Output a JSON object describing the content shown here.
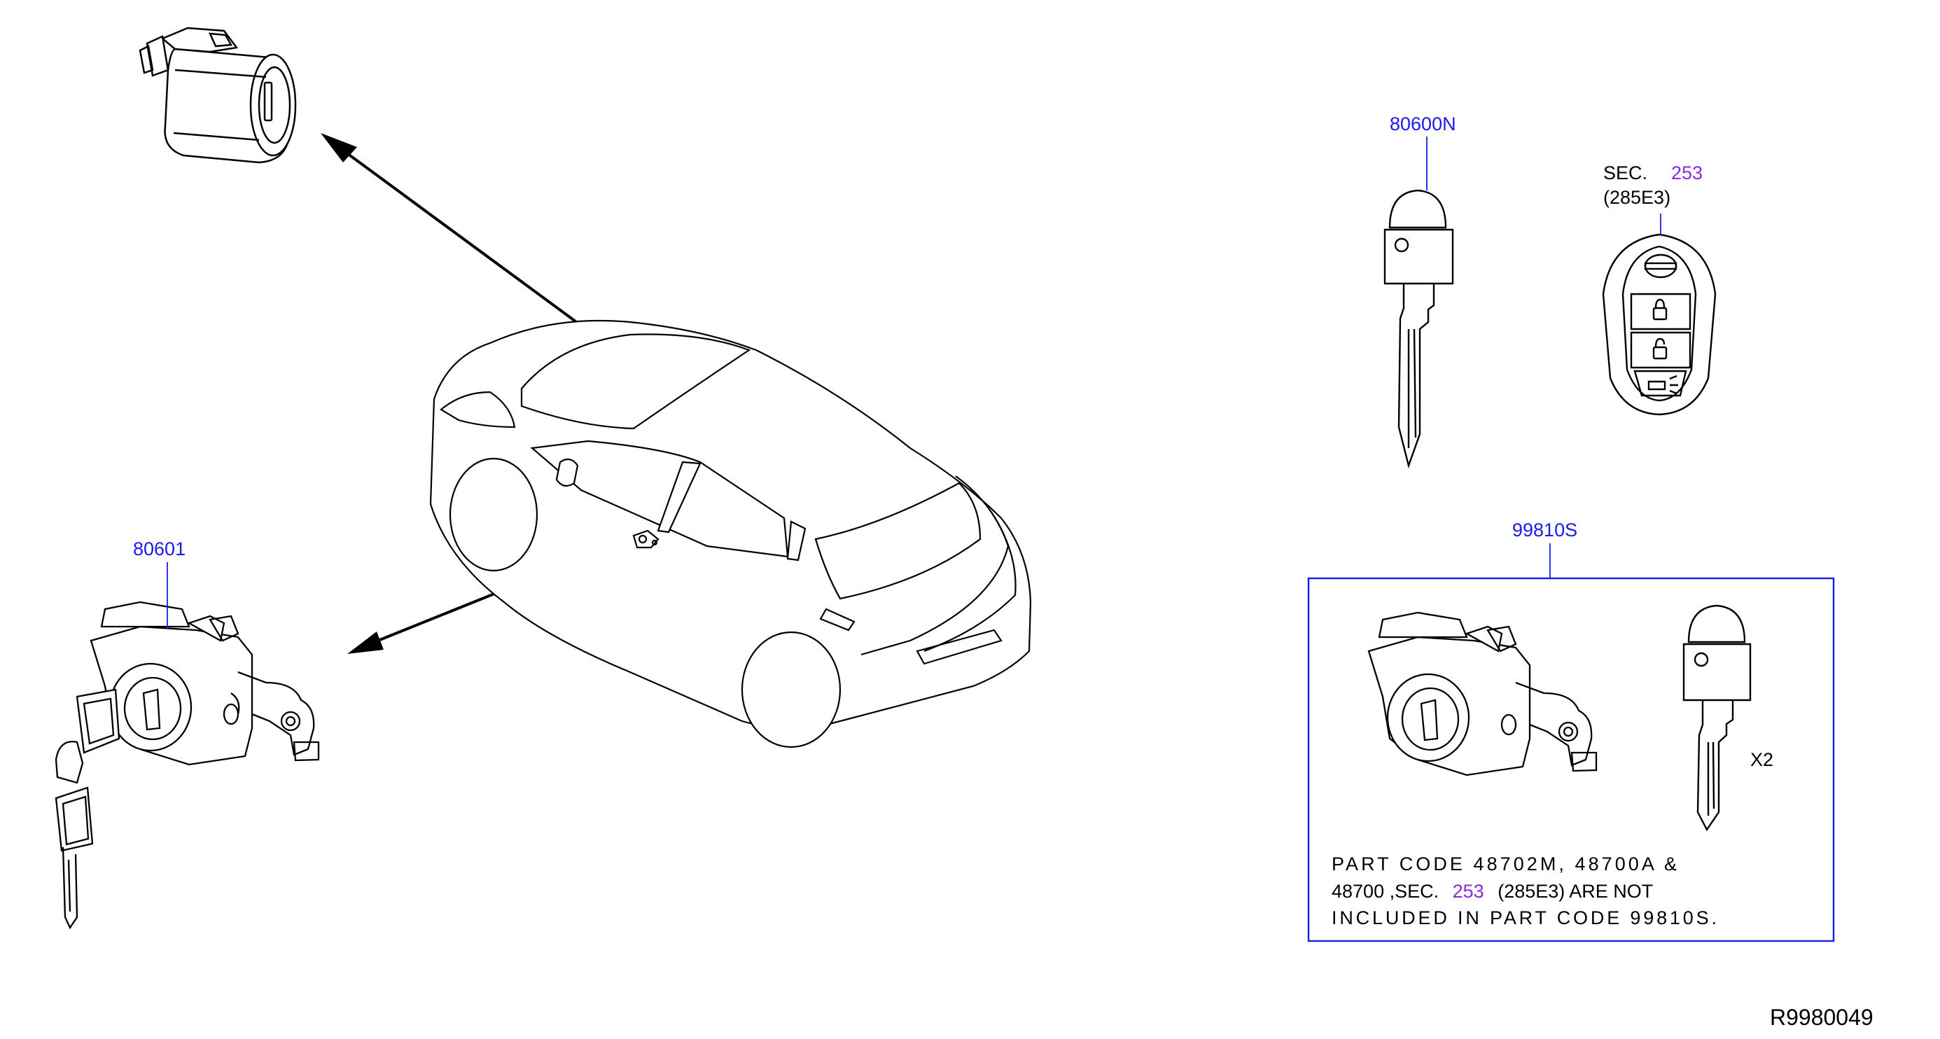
{
  "callouts": {
    "part_80600N": "80600N",
    "part_80601": "80601",
    "part_99810S": "99810S",
    "sec_prefix": "SEC.",
    "sec_number": "253",
    "sec_code": "(285E3)",
    "qty": "X2"
  },
  "note": {
    "line1": "PART CODE 48702M, 48700A &",
    "line2_a": "48700 ,SEC.",
    "line2_sec": "253",
    "line2_b": "(285E3) ARE NOT",
    "line3": "INCLUDED IN PART CODE 99810S."
  },
  "diagram_id": "R9980049",
  "colors": {
    "link": "#1a1aee",
    "sec_link": "#8a2be2",
    "line": "#000000"
  }
}
